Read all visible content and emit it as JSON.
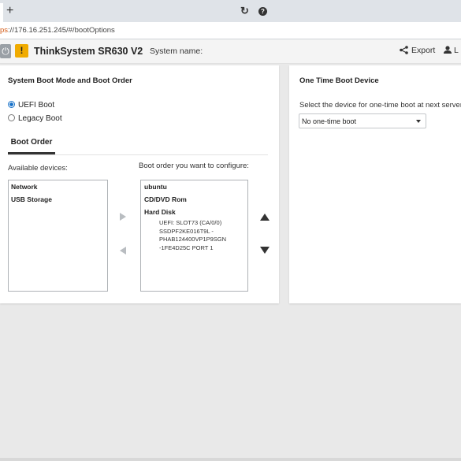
{
  "browser": {
    "new_tab": "+",
    "url_scheme": "ps",
    "url_rest": "://176.16.251.245/#/bootOptions"
  },
  "header": {
    "product": "ThinkSystem SR630 V2",
    "system_name_label": "System name:",
    "export_label": "Export",
    "user_label": "L"
  },
  "left_panel": {
    "title": "System Boot Mode and Boot Order",
    "boot_modes": [
      {
        "label": "UEFI Boot",
        "selected": true
      },
      {
        "label": "Legacy Boot",
        "selected": false
      }
    ],
    "tab_label": "Boot Order",
    "available_label": "Available devices:",
    "configure_label": "Boot order you want to configure:",
    "available_devices": [
      "Network",
      "USB Storage"
    ],
    "boot_order": [
      "ubuntu",
      "CD/DVD Rom",
      "Hard Disk"
    ],
    "hard_disk_detail": [
      "UEFI: SLOT73 (CA/0/0)",
      "SSDPF2KE016T9L -",
      "PHAB124400VP1P9SGN",
      "-1FE4D25C PORT 1"
    ]
  },
  "right_panel": {
    "title": "One Time Boot Device",
    "description": "Select the device for one-time boot at next server re",
    "select_value": "No one-time boot"
  },
  "colors": {
    "accent": "#1a73c9",
    "warning": "#f0ab00"
  }
}
